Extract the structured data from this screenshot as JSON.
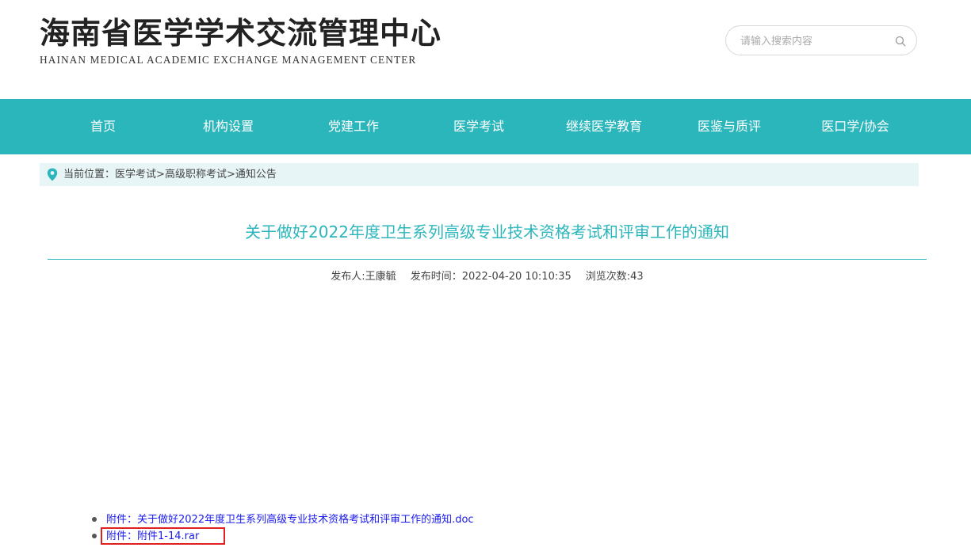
{
  "header": {
    "logo_cn": "海南省医学学术交流管理中心",
    "logo_en": "HAINAN MEDICAL ACADEMIC EXCHANGE MANAGEMENT CENTER",
    "search_placeholder": "请输入搜索内容"
  },
  "nav": {
    "items": [
      {
        "label": "首页"
      },
      {
        "label": "机构设置"
      },
      {
        "label": "党建工作"
      },
      {
        "label": "医学考试"
      },
      {
        "label": "继续医学教育"
      },
      {
        "label": "医鉴与质评"
      },
      {
        "label": "医口学/协会"
      }
    ]
  },
  "breadcrumb": {
    "prefix": "当前位置：",
    "items": [
      "医学考试",
      "高级职称考试",
      "通知公告"
    ],
    "separator": ">"
  },
  "article": {
    "title": "关于做好2022年度卫生系列高级专业技术资格考试和评审工作的通知",
    "publisher": "发布人:王康毓",
    "publish_time": "发布时间：2022-04-20 10:10:35",
    "views": "浏览次数:43"
  },
  "attachments": [
    {
      "label": "附件：关于做好2022年度卫生系列高级专业技术资格考试和评审工作的通知.doc"
    },
    {
      "label": "附件：附件1-14.rar"
    }
  ],
  "colors": {
    "accent": "#2bb6bc",
    "breadcrumb_bg": "#e8f5f6",
    "link": "#1a1aee",
    "highlight_box": "#e02020"
  },
  "icons": {
    "search": "search-icon",
    "location": "location-pin-icon"
  }
}
